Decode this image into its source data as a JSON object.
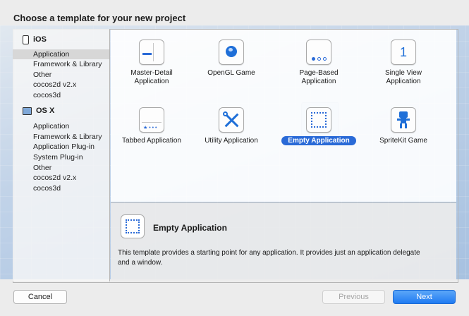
{
  "window": {
    "title": "Choose a template for your new project"
  },
  "sidebar": {
    "ios": {
      "heading": "iOS",
      "items": [
        "Application",
        "Framework & Library",
        "Other",
        "cocos2d v2.x",
        "cocos3d"
      ]
    },
    "osx": {
      "heading": "OS X",
      "items": [
        "Application",
        "Framework & Library",
        "Application Plug-in",
        "System Plug-in",
        "Other",
        "cocos2d v2.x",
        "cocos3d"
      ]
    },
    "selected": "iOS / Application"
  },
  "templates": [
    {
      "label_lines": [
        "Master-Detail",
        "Application"
      ],
      "icon": "master-detail-icon"
    },
    {
      "label_lines": [
        "OpenGL Game"
      ],
      "icon": "opengl-icon"
    },
    {
      "label_lines": [
        "Page-Based",
        "Application"
      ],
      "icon": "page-based-icon"
    },
    {
      "label_lines": [
        "Single View",
        "Application"
      ],
      "icon": "single-view-icon"
    },
    {
      "label_lines": [
        "Tabbed Application"
      ],
      "icon": "tabbed-icon"
    },
    {
      "label_lines": [
        "Utility Application"
      ],
      "icon": "utility-icon"
    },
    {
      "label_lines": [
        "Empty Application"
      ],
      "icon": "empty-app-icon",
      "selected": true
    },
    {
      "label_lines": [
        "SpriteKit Game"
      ],
      "icon": "spritekit-icon"
    }
  ],
  "single_view_glyph": "1",
  "description": {
    "title": "Empty Application",
    "text": "This template provides a starting point for any application. It provides just an application delegate and a window."
  },
  "buttons": {
    "cancel": "Cancel",
    "previous": "Previous",
    "next": "Next"
  },
  "colors": {
    "accent": "#2a6ad7",
    "selection_bg": "#d7d7d7"
  }
}
